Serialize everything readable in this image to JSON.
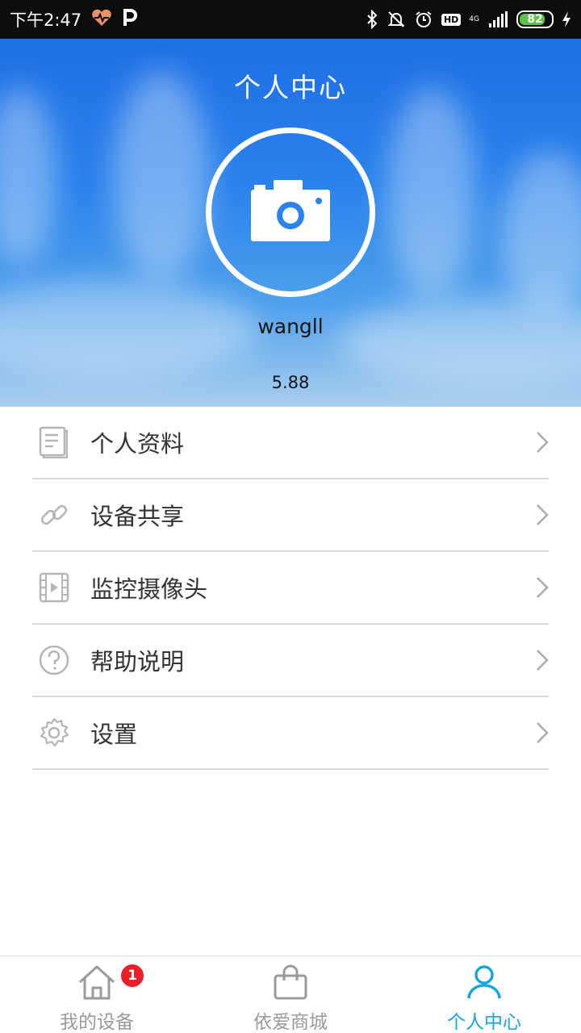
{
  "status_bar": {
    "time": "下午2:47",
    "network": "4G",
    "hd": "HD",
    "battery": "82",
    "battery_level": 0.82
  },
  "header": {
    "title": "个人中心",
    "username": "wangll",
    "balance": "5.88",
    "avatar_icon": "camera-icon"
  },
  "menu": {
    "items": [
      {
        "label": "个人资料",
        "icon": "document-icon"
      },
      {
        "label": "设备共享",
        "icon": "link-icon"
      },
      {
        "label": "监控摄像头",
        "icon": "video-icon"
      },
      {
        "label": "帮助说明",
        "icon": "help-icon"
      },
      {
        "label": "设置",
        "icon": "gear-icon"
      }
    ]
  },
  "bottom_nav": {
    "items": [
      {
        "label": "我的设备",
        "icon": "home-icon",
        "badge": "1"
      },
      {
        "label": "依爱商城",
        "icon": "shopping-bag-icon"
      },
      {
        "label": "个人中心",
        "icon": "person-icon",
        "active": true
      }
    ]
  },
  "colors": {
    "accent": "#1aa4e0",
    "badge": "#e8202a",
    "sky": "#2a82ec"
  }
}
